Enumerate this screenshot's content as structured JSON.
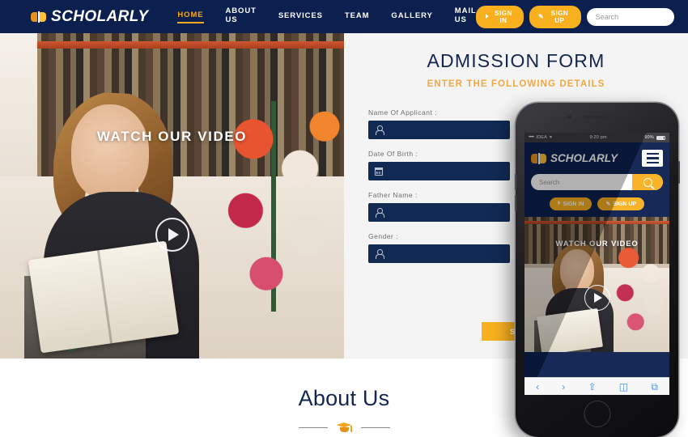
{
  "navbar": {
    "logo": {
      "text": "SCHOLARLY",
      "icon": "open-book-icon"
    },
    "links": [
      {
        "label": "HOME",
        "active": true
      },
      {
        "label": "ABOUT US",
        "active": false
      },
      {
        "label": "SERVICES",
        "active": false
      },
      {
        "label": "TEAM",
        "active": false
      },
      {
        "label": "GALLERY",
        "active": false
      },
      {
        "label": "MAIL US",
        "active": false
      }
    ],
    "sign_in_label": "SIGN IN",
    "sign_up_label": "SIGN UP",
    "search_placeholder": "Search",
    "search_value": "",
    "search_icon": "magnifier-icon"
  },
  "hero": {
    "overlay_text": "WATCH OUR VIDEO",
    "play_icon": "play-button-icon"
  },
  "form": {
    "title": "ADMISSION FORM",
    "subtitle": "ENTER THE FOLLOWING DETAILS",
    "fields": [
      {
        "label": "Name Of Applicant :",
        "icon": "user-icon",
        "value": "",
        "placeholder": ""
      },
      {
        "label": "Date Of Birth :",
        "icon": "calendar-icon",
        "value": "",
        "placeholder": ""
      },
      {
        "label": "Father Name :",
        "icon": "user-icon",
        "value": "",
        "placeholder": ""
      },
      {
        "label": "Gender :",
        "icon": "user-icon",
        "value": "",
        "placeholder": ""
      }
    ],
    "submit_label": "SUBMIT"
  },
  "phone": {
    "status": {
      "signal": "••••",
      "carrier": "IDEA",
      "wifi": "wifi-icon",
      "time": "9:20 pm",
      "battery": "90%"
    },
    "logo_text": "SCHOLARLY",
    "menu_icon": "hamburger-menu-icon",
    "search_placeholder": "Search",
    "search_value": "",
    "sign_in_label": "SIGN IN",
    "sign_up_label": "SIGN UP",
    "hero_text": "WATCH OUR VIDEO",
    "toolbar": [
      {
        "icon": "back-chevron-icon",
        "glyph": "‹"
      },
      {
        "icon": "forward-chevron-icon",
        "glyph": "›"
      },
      {
        "icon": "share-icon",
        "glyph": "⇧"
      },
      {
        "icon": "bookmarks-icon",
        "glyph": "◫"
      },
      {
        "icon": "tabs-icon",
        "glyph": "⧉"
      }
    ],
    "home_button": "home-button"
  },
  "about": {
    "title": "About Us",
    "divider_icon": "graduation-cap-icon"
  },
  "colors": {
    "navy": "#0c2050",
    "field_navy": "#102a54",
    "accent_gold": "#f8b01f",
    "subtitle_gold": "#f0a846",
    "panel_gray": "#f4f4f4"
  }
}
